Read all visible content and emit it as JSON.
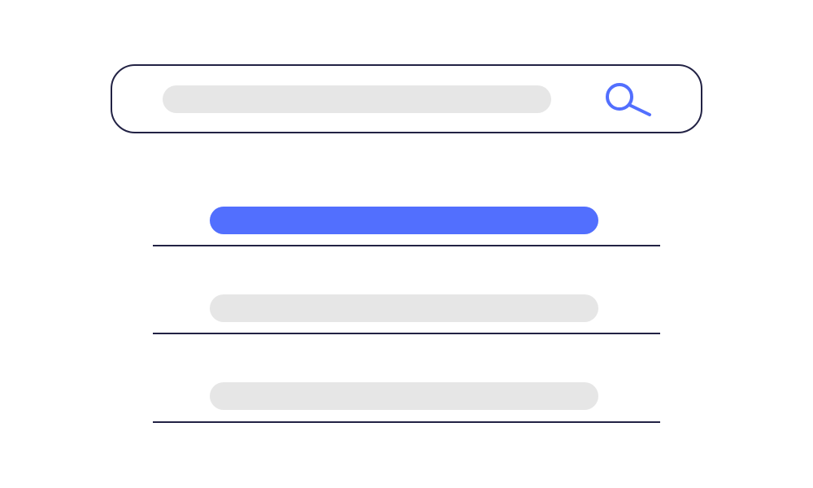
{
  "search": {
    "placeholder_text": "",
    "icon": "search-icon"
  },
  "results": [
    {
      "label": "",
      "selected": true
    },
    {
      "label": "",
      "selected": false
    },
    {
      "label": "",
      "selected": false
    }
  ],
  "colors": {
    "accent": "#526ffe",
    "placeholder_bar": "#e6e6e6",
    "outline": "#222244",
    "background": "#ffffff"
  }
}
